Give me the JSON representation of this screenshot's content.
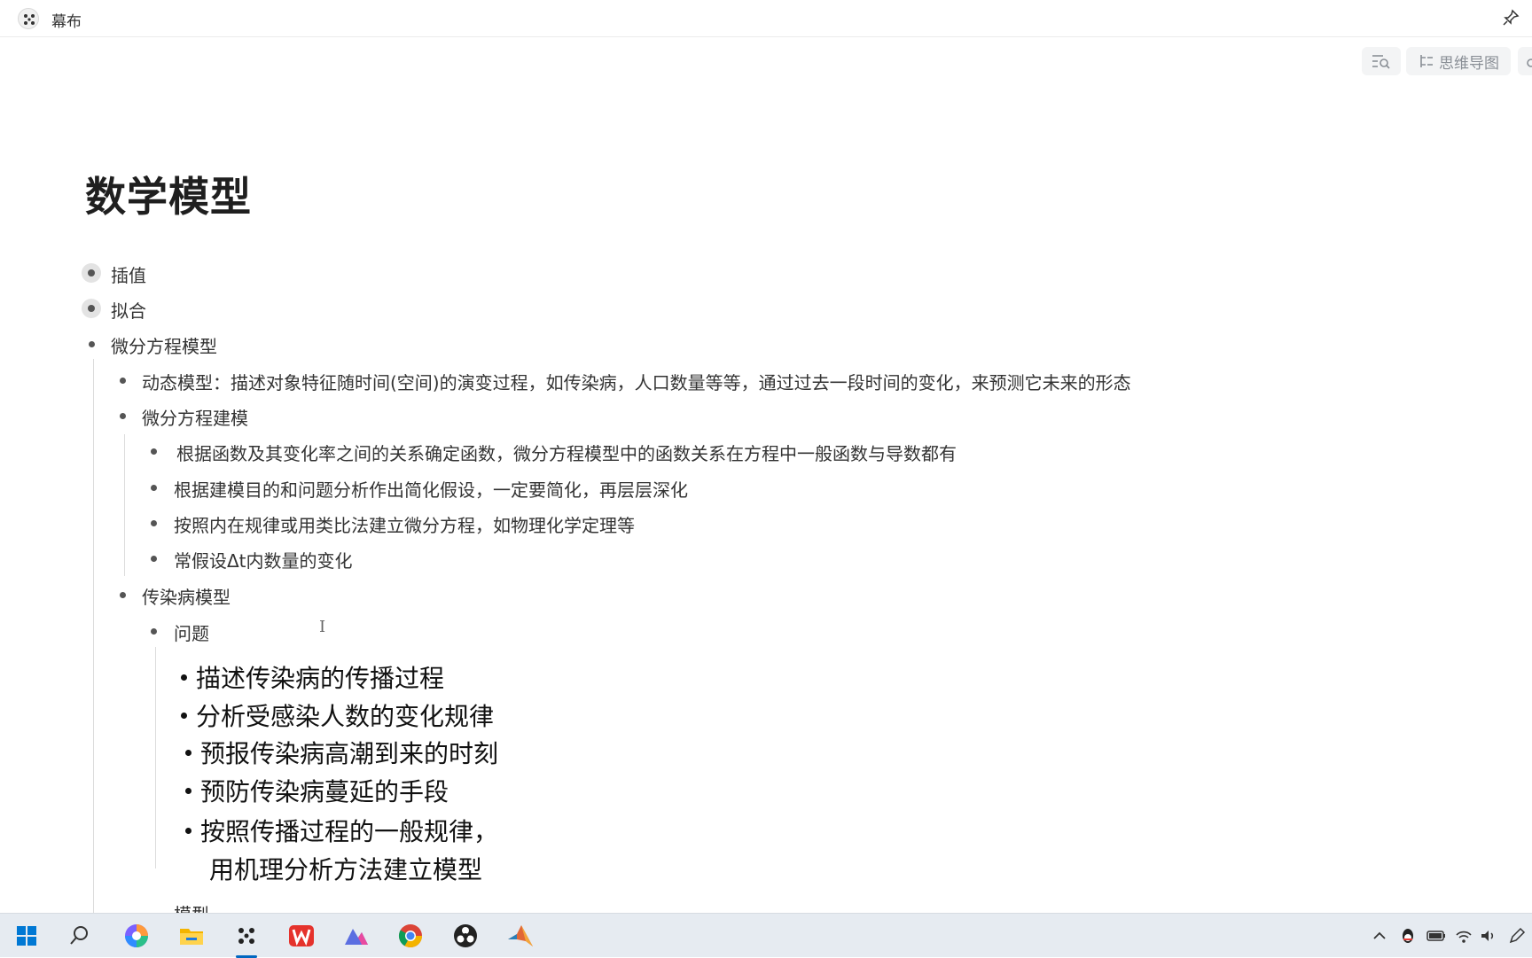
{
  "app": {
    "title": "幕布"
  },
  "toolbar": {
    "mindmap_label": "思维导图"
  },
  "document": {
    "title": "数学模型",
    "nodes": {
      "n1": "插值",
      "n2": "拟合",
      "n3": "微分方程模型",
      "n3_1": "动态模型：描述对象特征随时间(空间)的演变过程，如传染病，人口数量等等，通过过去一段时间的变化，来预测它未来的形态",
      "n3_2": "微分方程建模",
      "n3_2_1": "根据函数及其变化率之间的关系确定函数，微分方程模型中的函数关系在方程中一般函数与导数都有",
      "n3_2_2": "根据建模目的和问题分析作出简化假设，一定要简化，再层层深化",
      "n3_2_3": "按照内在规律或用类比法建立微分方程，如物理化学定理等",
      "n3_2_4": "常假设Δt内数量的变化",
      "n3_3": "传染病模型",
      "n3_3_1": "问题",
      "n3_3_2": "模型"
    },
    "embedded_image_lines": {
      "l1": "描述传染病的传播过程",
      "l2": "分析受感染人数的变化规律",
      "l3": "预报传染病高潮到来的时刻",
      "l4": "预防传染病蔓延的手段",
      "l5": "按照传播过程的一般规律，",
      "l6": "用机理分析方法建立模型"
    }
  },
  "taskbar": {
    "icons": [
      "windows-start-icon",
      "search-icon",
      "copilot-icon",
      "file-explorer-icon",
      "mubu-app-icon",
      "wps-office-icon",
      "edraw-icon",
      "chrome-icon",
      "obs-icon",
      "matlab-icon"
    ],
    "tray": [
      "chevron-up-icon",
      "qq-icon",
      "battery-icon",
      "wifi-icon",
      "volume-icon",
      "pen-icon"
    ]
  },
  "colors": {
    "taskbar_bg": "#e6ebf1",
    "active_indicator": "#0067c0"
  }
}
